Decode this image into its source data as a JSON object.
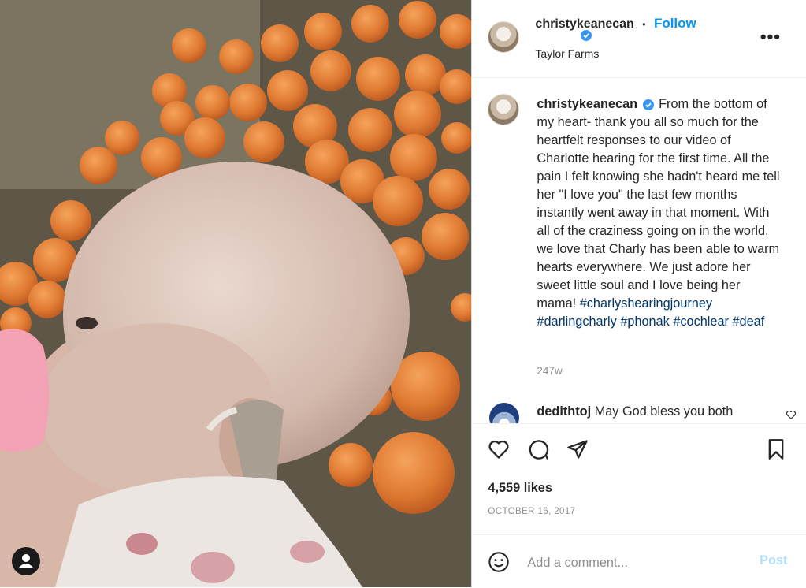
{
  "post": {
    "username": "christykeanecan",
    "follow_label": "Follow",
    "separator": "•",
    "location": "Taylor Farms",
    "more_label": "•••",
    "caption": "From the bottom of my heart- thank you all so much for the heartfelt responses to our video of Charlotte hearing for the first time. All the pain I felt knowing she hadn't heard me tell her \"I love you\" the last few months instantly went away in that moment. With all of the craziness going on in the world, we love that Charly has been able to warm hearts everywhere. We just adore her sweet little soul and I love being her mama!",
    "hashtags": [
      "#charlyshearingjourney",
      "#darlingcharly",
      "#phonak",
      "#cochlear",
      "#deaf"
    ],
    "age": "247w",
    "likes": "4,559 likes",
    "date": "OCTOBER 16, 2017"
  },
  "comment": {
    "username": "dedithtoj",
    "text": "May God bless you both"
  },
  "add_comment": {
    "placeholder": "Add a comment...",
    "post_label": "Post"
  },
  "colors": {
    "accent": "#0095f6",
    "hashtag": "#00376b",
    "muted": "#8e8e8e",
    "verified": "#3897f0"
  },
  "icons": [
    "heart-icon",
    "comment-icon",
    "share-icon",
    "bookmark-icon",
    "emoji-icon",
    "verified-icon",
    "more-icon",
    "user-icon"
  ]
}
